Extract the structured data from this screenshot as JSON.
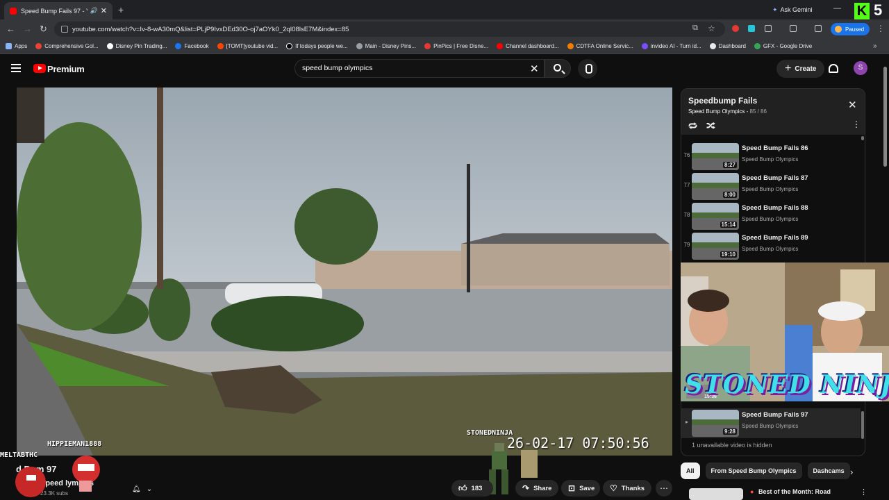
{
  "browser": {
    "tab_title": "Speed Bump Fails 97 - YouTube",
    "new_tab": "+",
    "ask_gemini": "Ask Gemini",
    "url": "youtube.com/watch?v=Iv-8-wA30mQ&list=PLjP9IvxDEd30O-oj7aOYk0_2qI08lsE7M&index=85",
    "paused_label": "Paused",
    "kick_badge": "5",
    "bookmarks": [
      {
        "label": "Apps",
        "color": "#8ab4f8"
      },
      {
        "label": "Comprehensive Gol...",
        "color": "#ea4335"
      },
      {
        "label": "Disney Pin Trading...",
        "color": "#ffffff"
      },
      {
        "label": "Facebook",
        "color": "#1877f2"
      },
      {
        "label": "[TOMT]youtube vid...",
        "color": "#ff4500"
      },
      {
        "label": "If todays people we...",
        "color": "#000000"
      },
      {
        "label": "Main - Disney Pins...",
        "color": "#9aa0a6"
      },
      {
        "label": "PinPics | Free Disne...",
        "color": "#e53935"
      },
      {
        "label": "Channel dashboard...",
        "color": "#ff0000"
      },
      {
        "label": "CDTFA Online Servic...",
        "color": "#f57c00"
      },
      {
        "label": "invideo AI - Turn id...",
        "color": "#7c4dff"
      },
      {
        "label": "Dashboard",
        "color": "#e8eaed"
      },
      {
        "label": "GFX - Google Drive",
        "color": "#34a853"
      }
    ]
  },
  "youtube": {
    "brand": "Premium",
    "search_value": "speed bump olympics",
    "create_label": "Create",
    "avatar_letter": "S"
  },
  "video": {
    "timestamp": "26-02-17  07:50:56",
    "overlay_names": [
      "STONEDNINJA",
      "HIPPIEMAN1888",
      "MELTABTHC"
    ],
    "title": "Speed Bump Fails 97",
    "title_visible": "d Bum      97",
    "channel": "Speed Bump Olympics",
    "channel_visible": "Speed        lympics",
    "subscribers": "23.3K subs",
    "likes": "183",
    "share": "Share",
    "save": "Save",
    "thanks": "Thanks"
  },
  "playlist": {
    "title": "Speedbump Fails",
    "channel": "Speed Bump Olympics",
    "position": "85 / 86",
    "items": [
      {
        "index": "76",
        "title": "Speed Bump Fails 86",
        "channel": "Speed Bump Olympics",
        "duration": "8:27"
      },
      {
        "index": "77",
        "title": "Speed Bump Fails 87",
        "channel": "Speed Bump Olympics",
        "duration": "8:00"
      },
      {
        "index": "78",
        "title": "Speed Bump Fails 88",
        "channel": "Speed Bump Olympics",
        "duration": "15:14"
      },
      {
        "index": "79",
        "title": "Speed Bump Fails 89",
        "channel": "Speed Bump Olympics",
        "duration": "19:10"
      }
    ],
    "current": {
      "title": "Speed Bump Fails 97",
      "channel": "Speed Bump Olympics",
      "duration": "9:28"
    },
    "partial_duration": "15:36",
    "hidden_note": "1 unavailable video is hidden"
  },
  "stream_overlay": "STONED NINJA",
  "chips": [
    "All",
    "From Speed Bump Olympics",
    "Dashcams"
  ],
  "recommendation": {
    "title": "Best of the Month: Road"
  }
}
